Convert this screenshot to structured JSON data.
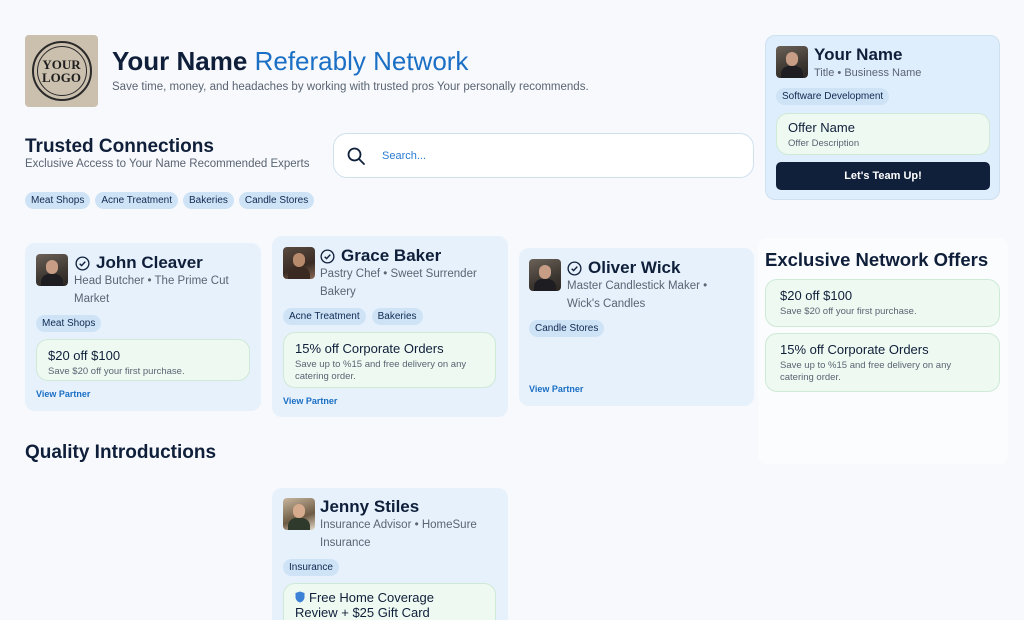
{
  "brand": {
    "logo_text": "YOUR LOGO",
    "title_prefix": "Your Name",
    "title_accent": "Referably Network",
    "subtitle": "Save time, money, and headaches by working with trusted pros Your personally recommends."
  },
  "trusted": {
    "title": "Trusted Connections",
    "subtitle": "Exclusive Access to Your Name Recommended Experts"
  },
  "search": {
    "placeholder": "Search..."
  },
  "filters": [
    "Meat Shops",
    "Acne Treatment",
    "Bakeries",
    "Candle Stores"
  ],
  "partners": [
    {
      "name": "John Cleaver",
      "role_line1": "Head Butcher • The Prime Cut",
      "role_line2": "Market",
      "tags": [
        "Meat Shops"
      ],
      "offer": {
        "title": "$20 off $100",
        "desc": "Save $20 off your first purchase."
      },
      "view_label": "View Partner"
    },
    {
      "name": "Grace Baker",
      "role_line1": "Pastry Chef • Sweet Surrender",
      "role_line2": "Bakery",
      "tags": [
        "Acne Treatment",
        "Bakeries"
      ],
      "offer": {
        "title": "15% off Corporate Orders",
        "desc_line1": "Save up to %15 and free delivery on any",
        "desc_line2": "catering order."
      },
      "view_label": "View Partner"
    },
    {
      "name": "Oliver Wick",
      "role_line1": "Master Candlestick Maker •",
      "role_line2": "Wick's Candles",
      "tags": [
        "Candle Stores"
      ],
      "view_label": "View Partner"
    }
  ],
  "quality": {
    "title": "Quality Introductions",
    "card": {
      "name": "Jenny Stiles",
      "role_line1": "Insurance Advisor • HomeSure",
      "role_line2": "Insurance",
      "tags": [
        "Insurance"
      ],
      "offer": {
        "title_line1": "Free Home Coverage",
        "title_line2": "Review + $25 Gift Card"
      }
    }
  },
  "profile": {
    "name": "Your Name",
    "title": "Title • Business Name",
    "tag": "Software Development",
    "offer": {
      "title": "Offer Name",
      "desc": "Offer Description"
    },
    "cta": "Let's Team Up!"
  },
  "network_offers": {
    "title": "Exclusive Network Offers",
    "items": [
      {
        "title": "$20 off $100",
        "desc_line1": "Save $20 off your first purchase."
      },
      {
        "title": "15% off Corporate Orders",
        "desc_line1": "Save up to %15 and free delivery on any",
        "desc_line2": "catering order."
      }
    ]
  },
  "colors": {
    "accent": "#1b6fc4",
    "card_bg": "#e6f1fc",
    "offer_bg": "#eef9f1",
    "button_bg": "#10203b"
  }
}
